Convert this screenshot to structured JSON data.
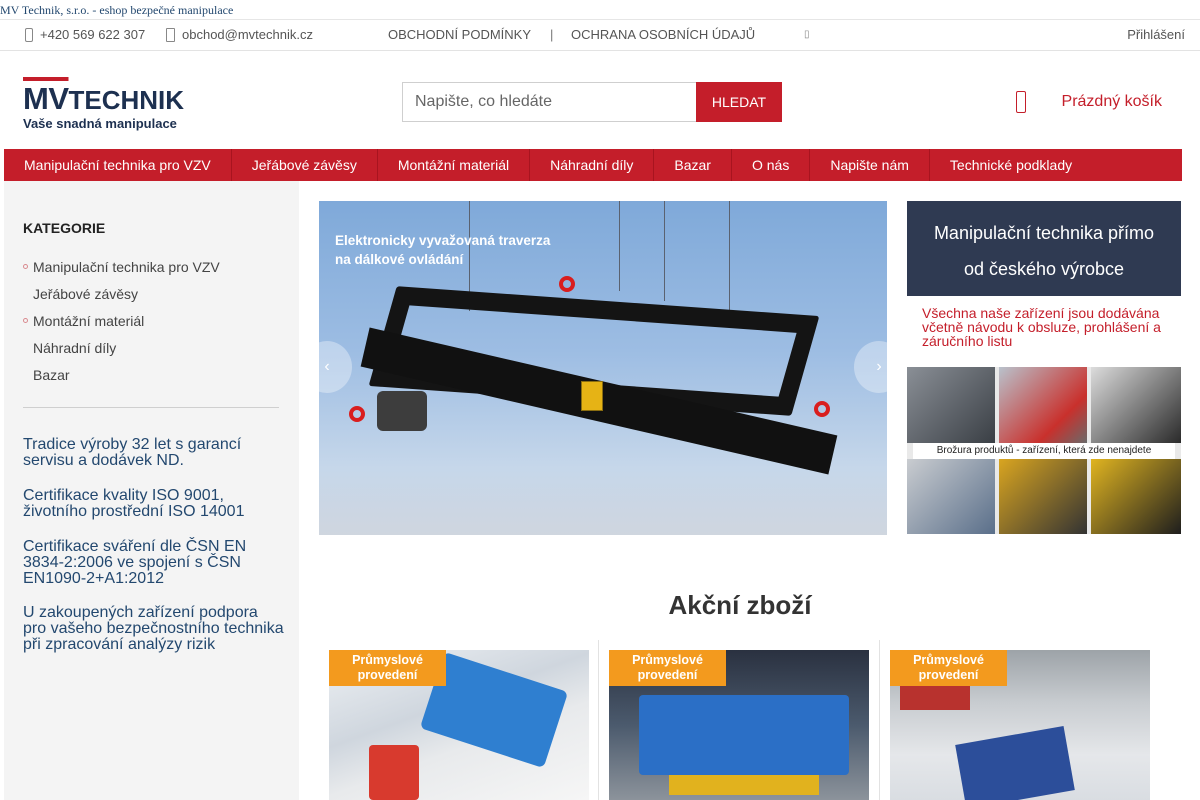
{
  "browser": {
    "title": "MV Technik, s.r.o. - eshop bezpečné manipulace"
  },
  "topbar": {
    "phone": "+420 569 622 307",
    "email": "obchod@mvtechnik.cz",
    "terms": "OBCHODNÍ PODMÍNKY",
    "separator": "|",
    "privacy": "OCHRANA OSOBNÍCH ÚDAJŮ",
    "more_glyph": "▯",
    "login": "Přihlášení"
  },
  "header": {
    "logo": {
      "mark": "MV",
      "word": "TECHNIK",
      "tagline": "Vaše snadná manipulace"
    },
    "search": {
      "placeholder": "Napište, co hledáte",
      "button": "HLEDAT"
    },
    "cart": {
      "label": "Prázdný košík",
      "icon": "cart-icon"
    }
  },
  "nav": {
    "items": [
      "Manipulační technika pro VZV",
      "Jeřábové závěsy",
      "Montážní materiál",
      "Náhradní díly",
      "Bazar",
      "O nás",
      "Napište nám",
      "Technické podklady"
    ]
  },
  "sidebar": {
    "heading": "KATEGORIE",
    "categories": [
      {
        "label": "Manipulační technika pro VZV",
        "has_sub": true
      },
      {
        "label": "Jeřábové závěsy",
        "has_sub": false
      },
      {
        "label": "Montážní materiál",
        "has_sub": true
      },
      {
        "label": "Náhradní díly",
        "has_sub": false
      },
      {
        "label": "Bazar",
        "has_sub": false
      }
    ],
    "usps": [
      "Tradice výroby 32 let s garancí servisu a dodávek ND.",
      "Certifikace kvality ISO 9001, životního prostřední ISO 14001",
      "Certifikace sváření dle ČSN EN 3834-2:2006 ve spojení s ČSN EN1090-2+A1:2012",
      "U zakoupených zařízení podpora pro vašeho bezpečnostního technika při zpracování analýzy rizik"
    ]
  },
  "slider": {
    "caption_line1": "Elektronicky vyvažovaná traverza",
    "caption_line2": "na dálkové ovládání",
    "prev_glyph": "‹",
    "next_glyph": "›"
  },
  "promo": {
    "title_line1": "Manipulační technika přímo",
    "title_line2": "od českého výrobce",
    "note": "Všechna naše zařízení jsou dodávána včetně návodu k obsluze, prohlášení a záručního listu",
    "brochure_caption": "Brožura produktů - zařízení, která zde nenajdete"
  },
  "featured": {
    "title": "Akční zboží",
    "products": [
      {
        "badge_line1": "Průmyslové",
        "badge_line2": "provedení"
      },
      {
        "badge_line1": "Průmyslové",
        "badge_line2": "provedení"
      },
      {
        "badge_line1": "Průmyslové",
        "badge_line2": "provedení"
      }
    ]
  },
  "colors": {
    "brand_red": "#c41e2a",
    "navy": "#2f3a52",
    "link_blue": "#23486f",
    "badge_orange": "#f39a1e"
  }
}
